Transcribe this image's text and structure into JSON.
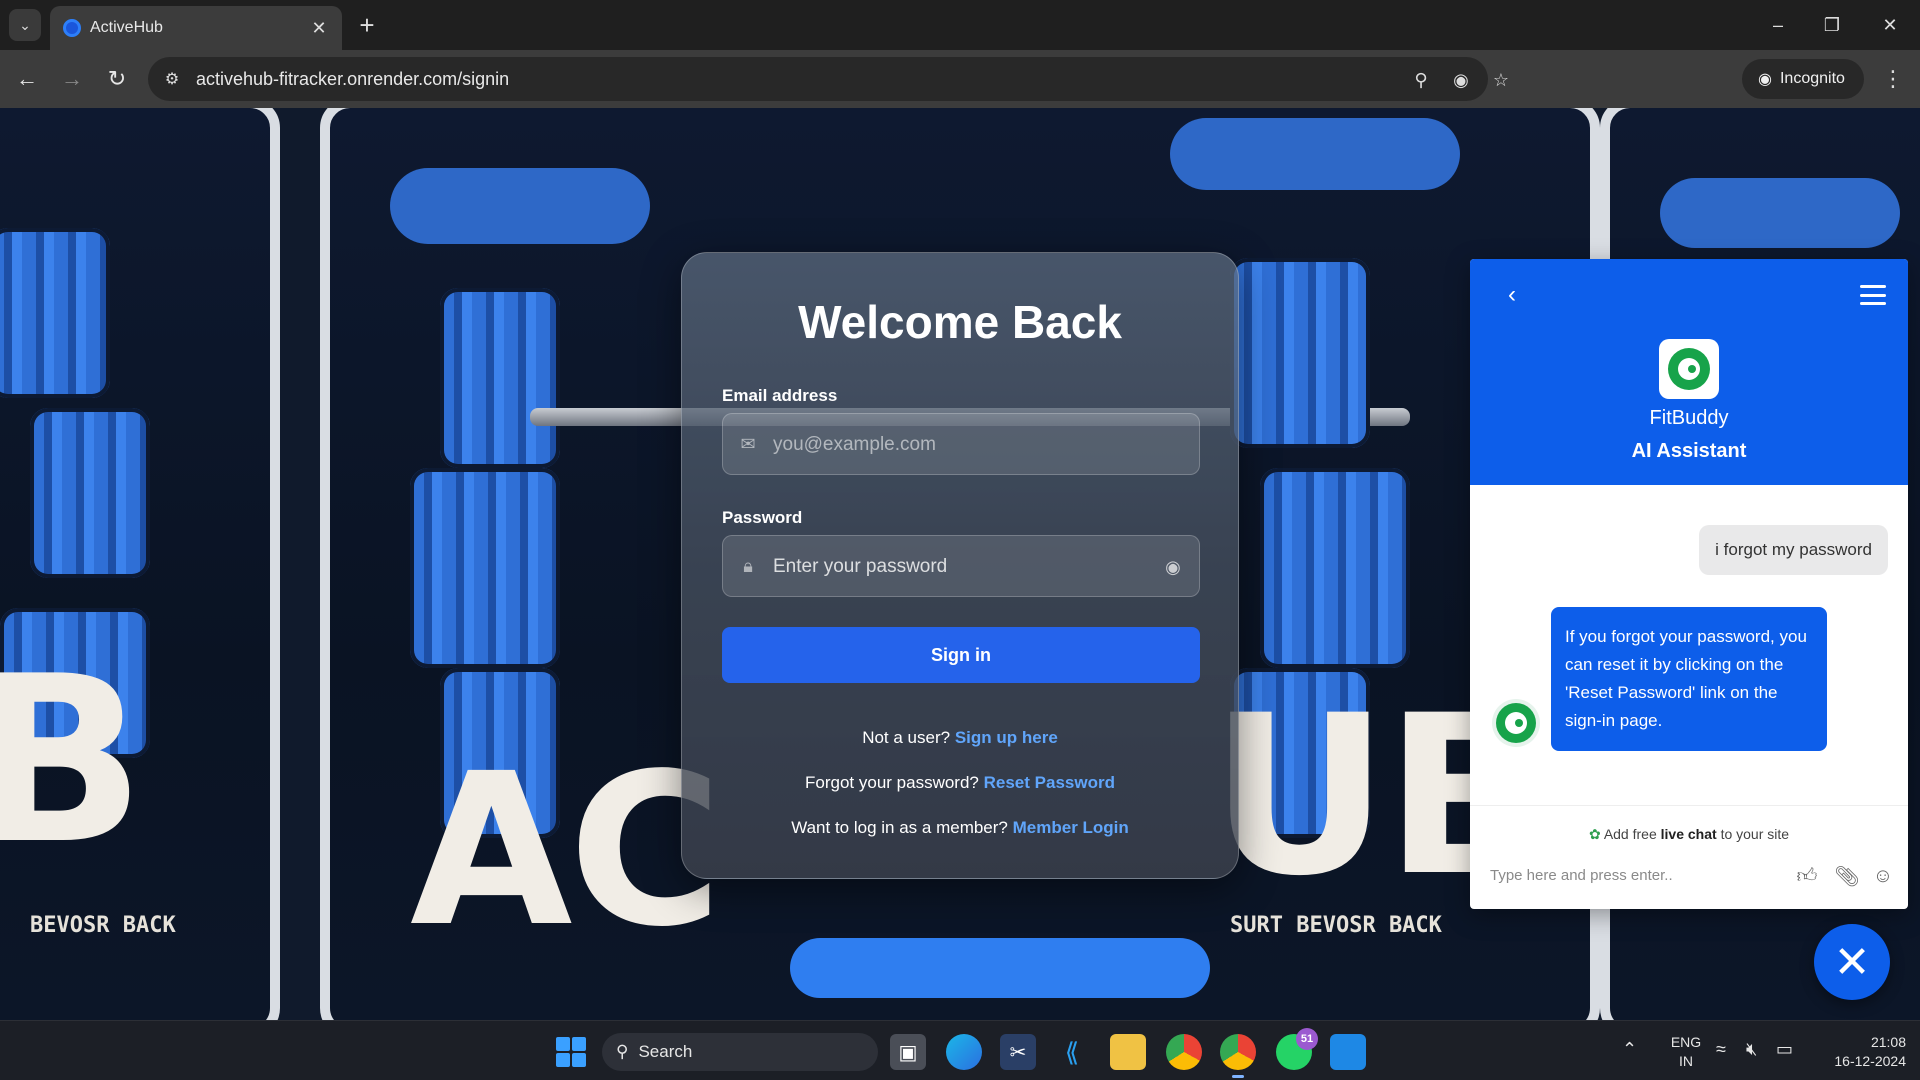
{
  "browser": {
    "tab_title": "ActiveHub",
    "url": "activehub-fitracker.onrender.com/signin",
    "incognito_label": "Incognito"
  },
  "signin": {
    "title": "Welcome Back",
    "email_label": "Email address",
    "email_placeholder": "you@example.com",
    "password_label": "Password",
    "password_placeholder": "Enter your password",
    "submit_label": "Sign in",
    "signup_prompt": "Not a user?",
    "signup_link": "Sign up here",
    "forgot_prompt": "Forgot your password?",
    "forgot_link": "Reset Password",
    "member_prompt": "Want to log in as a member?",
    "member_link": "Member Login"
  },
  "chat": {
    "bot_name": "FitBuddy",
    "bot_role": "AI Assistant",
    "messages": [
      {
        "from": "user",
        "text": "i forgot my password"
      },
      {
        "from": "bot",
        "text": "If you forgot your password, you can reset it by clicking on the 'Reset Password' link on the sign-in page."
      }
    ],
    "promo_prefix": "Add free",
    "promo_bold": "live chat",
    "promo_suffix": "to your site",
    "input_placeholder": "Type here and press enter.."
  },
  "taskbar": {
    "search_label": "Search",
    "whatsapp_badge": "51",
    "lang_line1": "ENG",
    "lang_line2": "IN",
    "time": "21:08",
    "date": "16-12-2024"
  },
  "colors": {
    "primary_button": "#2563eb",
    "chat_accent": "#0d5eea",
    "link": "#60a5fa"
  }
}
